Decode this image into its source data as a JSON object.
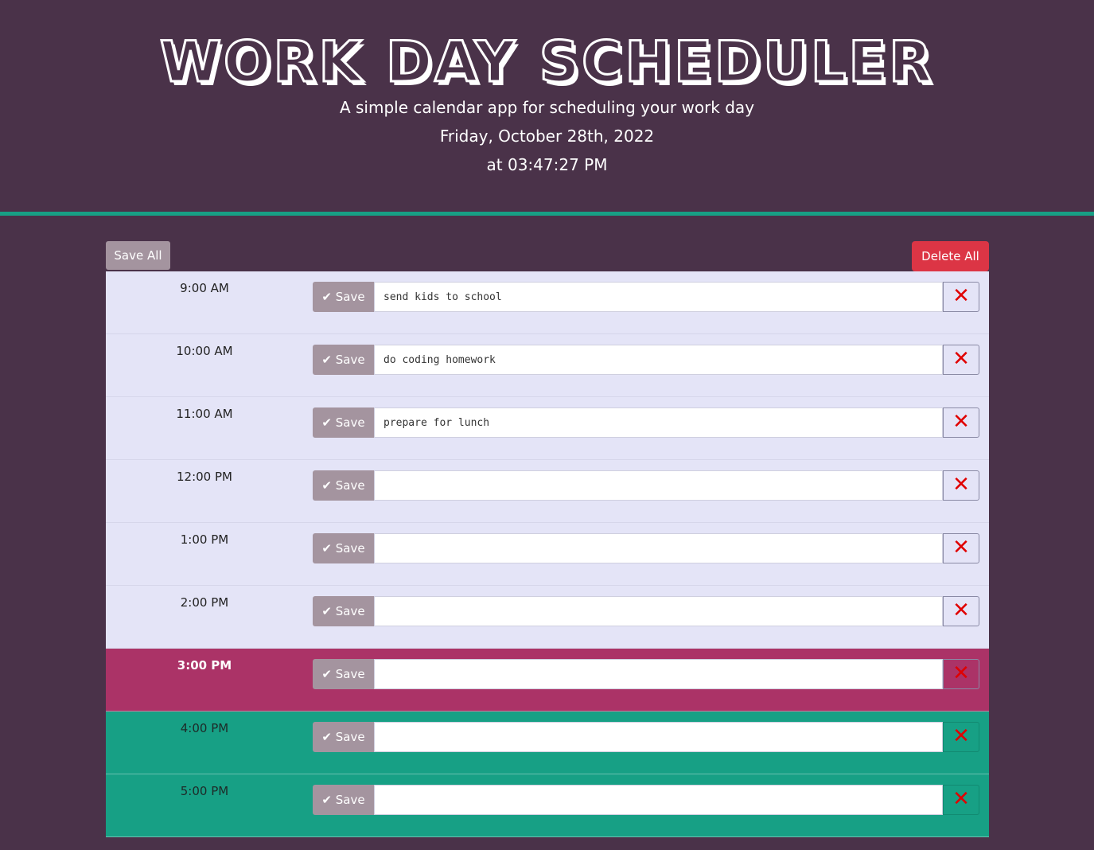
{
  "header": {
    "title": "WORK DAY SCHEDULER",
    "subtitle": "A simple calendar app for scheduling your work day",
    "date": "Friday, October 28th, 2022",
    "time": "at 03:47:27 PM"
  },
  "toolbar": {
    "save_all_label": "Save All",
    "delete_all_label": "Delete All"
  },
  "rows": [
    {
      "hour": "9:00 AM",
      "save_label": "✔ Save",
      "task": "send kids to school",
      "state": "past"
    },
    {
      "hour": "10:00 AM",
      "save_label": "✔ Save",
      "task": "do coding homework",
      "state": "past"
    },
    {
      "hour": "11:00 AM",
      "save_label": "✔ Save",
      "task": "prepare for lunch",
      "state": "past"
    },
    {
      "hour": "12:00 PM",
      "save_label": "✔ Save",
      "task": "",
      "state": "past"
    },
    {
      "hour": "1:00 PM",
      "save_label": "✔ Save",
      "task": "",
      "state": "past"
    },
    {
      "hour": "2:00 PM",
      "save_label": "✔ Save",
      "task": "",
      "state": "past"
    },
    {
      "hour": "3:00 PM",
      "save_label": "✔ Save",
      "task": "",
      "state": "present"
    },
    {
      "hour": "4:00 PM",
      "save_label": "✔ Save",
      "task": "",
      "state": "future"
    },
    {
      "hour": "5:00 PM",
      "save_label": "✔ Save",
      "task": "",
      "state": "future"
    }
  ],
  "delete_glyph": "✕",
  "colors": {
    "background": "#4a3249",
    "past": "#e4e4f7",
    "present": "#ab3367",
    "future": "#17a085",
    "accent": "#17a085",
    "danger": "#dc3545",
    "save": "#a4949f"
  }
}
